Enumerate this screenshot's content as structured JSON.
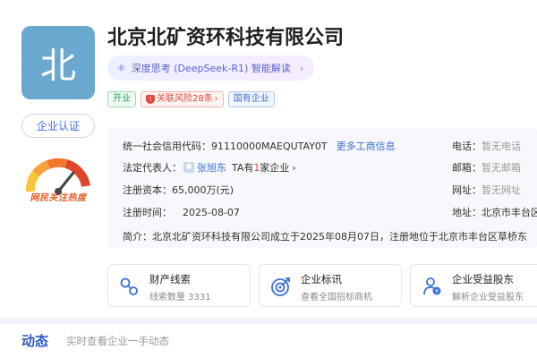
{
  "company": {
    "logo_char": "北",
    "name": "北京北矿资环科技有限公司",
    "cert_label": "企业认证",
    "heat_label": "网民关注热度"
  },
  "ai": {
    "label": "深度思考 (DeepSeek-R1) 智能解读"
  },
  "tags": {
    "status": "开业",
    "risk": "关联风险28条",
    "type": "国有企业"
  },
  "info": {
    "credit_code_label": "统一社会信用代码：",
    "credit_code": "91110000MAEQUTAY0T",
    "more_link": "更多工商信息",
    "legal_rep_label": "法定代表人：",
    "legal_rep_name": "张旭东",
    "legal_rep_prefix": "TA有",
    "legal_rep_count": "1",
    "legal_rep_suffix": "家企业",
    "capital_label": "注册资本：",
    "capital_value": "65,000万(元)",
    "reg_time_label": "注册时间：",
    "reg_time_value": "2025-08-07",
    "phone_label": "电话：",
    "phone_value": "暂无电话",
    "email_label": "邮箱：",
    "email_value": "暂无邮箱",
    "website_label": "网址：",
    "website_value": "暂无网址",
    "address_label": "地址：",
    "address_value": "北京市丰台区",
    "intro_label": "简介：",
    "intro_value": "北京北矿资环科技有限公司成立于2025年08月07日，注册地位于北京市丰台区草桥东"
  },
  "feature_cards": [
    {
      "title": "财产线索",
      "subtitle": "线索数量 3331",
      "icon": "property-clue-icon"
    },
    {
      "title": "企业标讯",
      "subtitle": "查看全国招标商机",
      "icon": "bid-target-icon"
    },
    {
      "title": "企业受益股东",
      "subtitle": "解析企业受益股东",
      "icon": "shareholder-icon"
    }
  ],
  "dynamic": {
    "title": "动态",
    "subtitle": "实时查看企业一手动态"
  },
  "colors": {
    "accent": "#3d6fd8",
    "logo_bg": "#6aa8d0",
    "risk": "#e04a3a",
    "open": "#2aa35a"
  }
}
